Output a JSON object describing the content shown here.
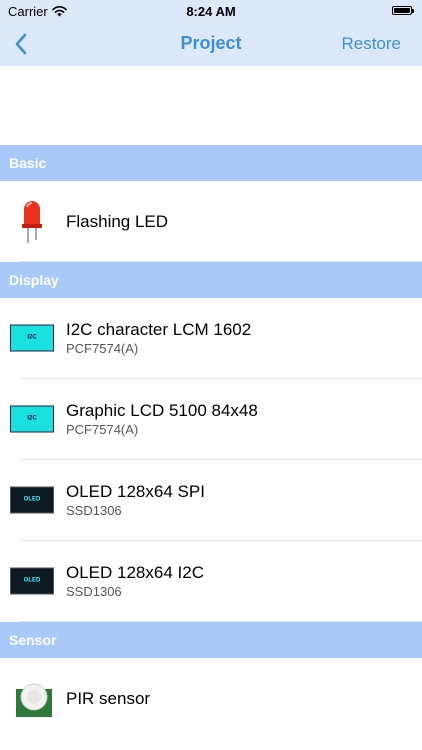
{
  "status_bar": {
    "carrier": "Carrier",
    "time": "8:24 AM"
  },
  "nav": {
    "title": "Project",
    "back_icon": "chevron-left-icon",
    "restore_label": "Restore"
  },
  "colors": {
    "accent": "#3a8fd6",
    "section_header_bg": "#a9c9fa",
    "nav_bg": "#dde9fb",
    "lcd_cyan": "#1ae0e0",
    "oled_dark": "#0d1a22",
    "led_red": "#e8321e"
  },
  "sections": [
    {
      "title": "Basic",
      "items": [
        {
          "title": "Flashing LED",
          "subtitle": "",
          "icon": "red-led-icon"
        }
      ]
    },
    {
      "title": "Display",
      "items": [
        {
          "title": "I2C character LCM 1602",
          "subtitle": "PCF7574(A)",
          "icon": "lcd-module-icon",
          "icon_label": "I2C"
        },
        {
          "title": "Graphic LCD 5100 84x48",
          "subtitle": "PCF7574(A)",
          "icon": "lcd-module-icon",
          "icon_label": "I2C"
        },
        {
          "title": "OLED 128x64 SPI",
          "subtitle": "SSD1306",
          "icon": "oled-module-icon",
          "icon_label": "OLED"
        },
        {
          "title": "OLED 128x64 I2C",
          "subtitle": "SSD1306",
          "icon": "oled-module-icon",
          "icon_label": "OLED"
        }
      ]
    },
    {
      "title": "Sensor",
      "items": [
        {
          "title": "PIR sensor",
          "subtitle": "",
          "icon": "pir-sensor-icon"
        }
      ]
    }
  ]
}
